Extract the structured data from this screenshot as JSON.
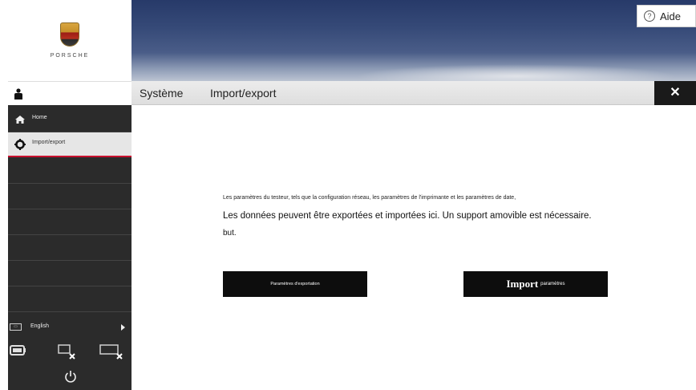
{
  "sidebar": {
    "logo_wordmark": "PORSCHE",
    "nav": [
      {
        "label": "Home",
        "icon": "home-icon",
        "active": false
      },
      {
        "label": "Import/export",
        "icon": "gear-icon",
        "active": true
      }
    ],
    "language": {
      "label": "English",
      "icon": "language-icon"
    },
    "tools": [
      "battery-icon",
      "monitor-disconnected-icon",
      "display-disconnected-icon"
    ],
    "power_icon": "power-icon"
  },
  "header": {
    "help_label": "Aide",
    "help_icon": "?"
  },
  "titlebar": {
    "crumb_system": "Système",
    "crumb_page": "Import/export",
    "close_glyph": "✕"
  },
  "main": {
    "desc_line1": "Les paramètres du testeur, tels que la configuration réseau, les paramètres de l'imprimante et les paramètres de date,",
    "desc_line2": "Les données peuvent être exportées et importées ici. Un support amovible est nécessaire.",
    "desc_line3": "but.",
    "export_button": "Paramètres d'exportation",
    "import_button_big": "Import",
    "import_button_small": "paramètres"
  },
  "colors": {
    "accent_red": "#c8102e",
    "sidebar_bg": "#2b2b2b",
    "button_bg": "#0d0d0d"
  }
}
